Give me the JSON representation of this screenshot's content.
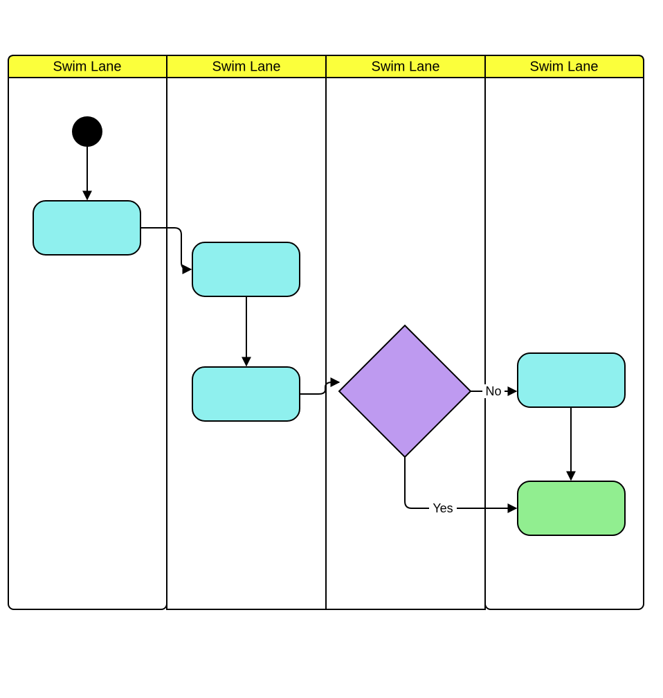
{
  "diagram": {
    "lanes": [
      {
        "label": "Swim Lane"
      },
      {
        "label": "Swim Lane"
      },
      {
        "label": "Swim Lane"
      },
      {
        "label": "Swim Lane"
      }
    ],
    "edges": {
      "yes_label": "Yes",
      "no_label": "No"
    }
  }
}
